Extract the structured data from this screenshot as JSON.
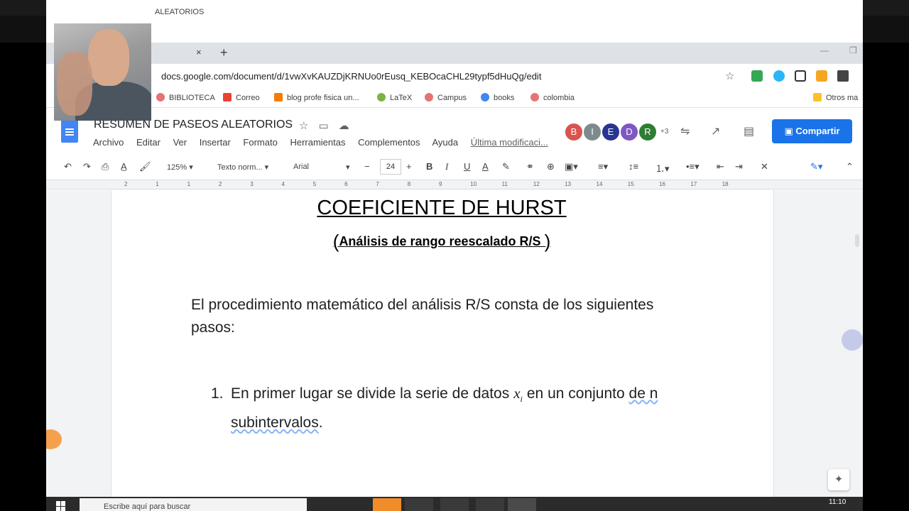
{
  "browser": {
    "tab_title": "ALEATORIOS",
    "tab_close": "×",
    "tab_new": "+",
    "url": "docs.google.com/document/d/1vwXvKAUZDjKRNUo0rEusq_KEBOcaCHL29typf5dHuQg/edit",
    "bookmarks": [
      "BIBLIOTECA",
      "Correo",
      "blog profe fisica un...",
      "LaTeX",
      "Campus",
      "books",
      "colombia"
    ],
    "other_bookmarks": "Otros ma"
  },
  "docs": {
    "title": "RESUMEN DE PASEOS ALEATORIOS",
    "menu": [
      "Archivo",
      "Editar",
      "Ver",
      "Insertar",
      "Formato",
      "Herramientas",
      "Complementos",
      "Ayuda"
    ],
    "last_edit": "Última modificaci...",
    "collaborators": [
      {
        "initial": "B",
        "color": "#d9534f"
      },
      {
        "initial": "I",
        "color": "#7d8b8f"
      },
      {
        "initial": "E",
        "color": "#283593"
      },
      {
        "initial": "D",
        "color": "#7e57c2"
      },
      {
        "initial": "R",
        "color": "#2e7d32"
      }
    ],
    "more_collaborators": "+3",
    "share_label": "Compartir",
    "toolbar": {
      "zoom": "125%",
      "style": "Texto norm...",
      "font": "Arial",
      "font_size": "24",
      "minus": "−",
      "plus": "+",
      "bold": "B",
      "italic": "I",
      "underline": "U",
      "text_color": "A"
    },
    "ruler_ticks": [
      "2",
      "1",
      "1",
      "2",
      "3",
      "4",
      "5",
      "6",
      "7",
      "8",
      "9",
      "10",
      "11",
      "12",
      "13",
      "14",
      "15",
      "16",
      "17",
      "18"
    ]
  },
  "document": {
    "heading": "COEFICIENTE DE HURST",
    "subheading": "Análisis de rango reescalado R/S",
    "paren_open": "(",
    "paren_close": ")",
    "paragraph": "El procedimiento matemático del análisis R/S consta de los siguientes pasos:",
    "list_number": "1.",
    "item_text_before": "En primer lugar se divide la serie de datos",
    "item_var": "x",
    "item_var_sub": "i",
    "item_text_after": "en un conjunto",
    "item_text_underlined": "de n subintervalos",
    "item_text_end": "."
  },
  "taskbar": {
    "search_placeholder": "Escribe aquí para buscar",
    "time": "11:10"
  }
}
